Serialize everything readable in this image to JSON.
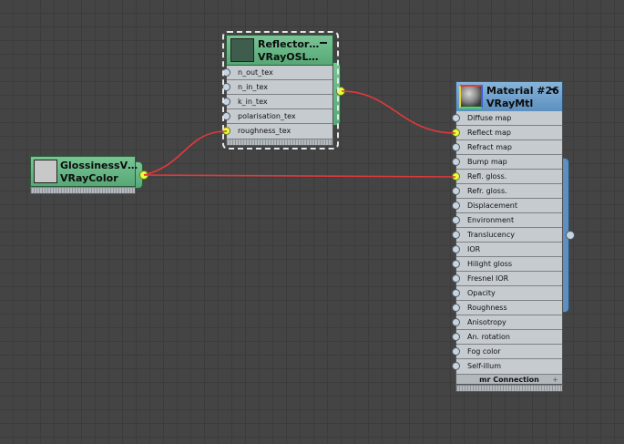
{
  "nodes": {
    "reflector": {
      "title_line1": "Reflector…",
      "title_line2": "VRayOSL…",
      "color": "#5aae7a",
      "slots": [
        "n_out_tex",
        "n_in_tex",
        "k_in_tex",
        "polarisation_tex",
        "roughness_tex"
      ],
      "connected_slot": "roughness_tex"
    },
    "glossiness": {
      "title_line1": "GlossinessV…",
      "title_line2": "VRayColor",
      "color": "#5aae7a",
      "swatch_color": "#c8c8c8"
    },
    "material": {
      "title_line1": "Material #26",
      "title_line2": "VRayMtl",
      "color": "#6d9fcd",
      "slots": [
        "Diffuse map",
        "Reflect map",
        "Refract map",
        "Bump map",
        "Refl. gloss.",
        "Refr. gloss.",
        "Displacement",
        "Environment",
        "Translucency",
        "IOR",
        "Hilight gloss",
        "Fresnel IOR",
        "Opacity",
        "Roughness",
        "Anisotropy",
        "An. rotation",
        "Fog color",
        "Self-illum"
      ],
      "connected_slots": [
        "Reflect map",
        "Refl. gloss."
      ],
      "footer": "mr Connection",
      "footer_icon": "+"
    }
  },
  "wires": {
    "color": "#e0393c",
    "links": [
      {
        "from": "reflector.output",
        "to": "material.Reflect map"
      },
      {
        "from": "glossiness.output",
        "to": "reflector.roughness_tex"
      },
      {
        "from": "glossiness.output",
        "to": "material.Refl. gloss."
      }
    ]
  }
}
